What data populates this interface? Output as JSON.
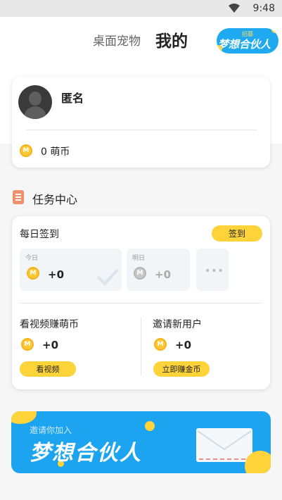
{
  "status_bar": {
    "time": "9:48",
    "wifi_icon": "wifi-icon"
  },
  "header": {
    "tabs": [
      {
        "label": "桌面宠物"
      },
      {
        "label": "我的"
      }
    ],
    "partner_badge": {
      "small_label": "招募",
      "title": "梦想合伙人"
    }
  },
  "profile": {
    "username": "匿名",
    "coin_balance": "0 萌币",
    "avatar_icon": "default-avatar-icon"
  },
  "task_center": {
    "title": "任务中心",
    "daily_checkin": {
      "title": "每日签到",
      "button_label": "签到",
      "days": [
        {
          "label": "今日",
          "value": "+0"
        },
        {
          "label": "明日",
          "value": "+0"
        }
      ],
      "more": "•••"
    },
    "tasks": [
      {
        "name": "看视频赚萌币",
        "reward": "+0",
        "button_label": "看视频"
      },
      {
        "name": "邀请新用户",
        "reward": "+0",
        "button_label": "立即赚金币"
      }
    ]
  },
  "banner": {
    "subtitle": "邀请你加入",
    "title": "梦想合伙人"
  },
  "colors": {
    "accent_yellow": "#fdd33a",
    "banner_blue": "#1ca4f0",
    "coin": "#fcc832"
  }
}
